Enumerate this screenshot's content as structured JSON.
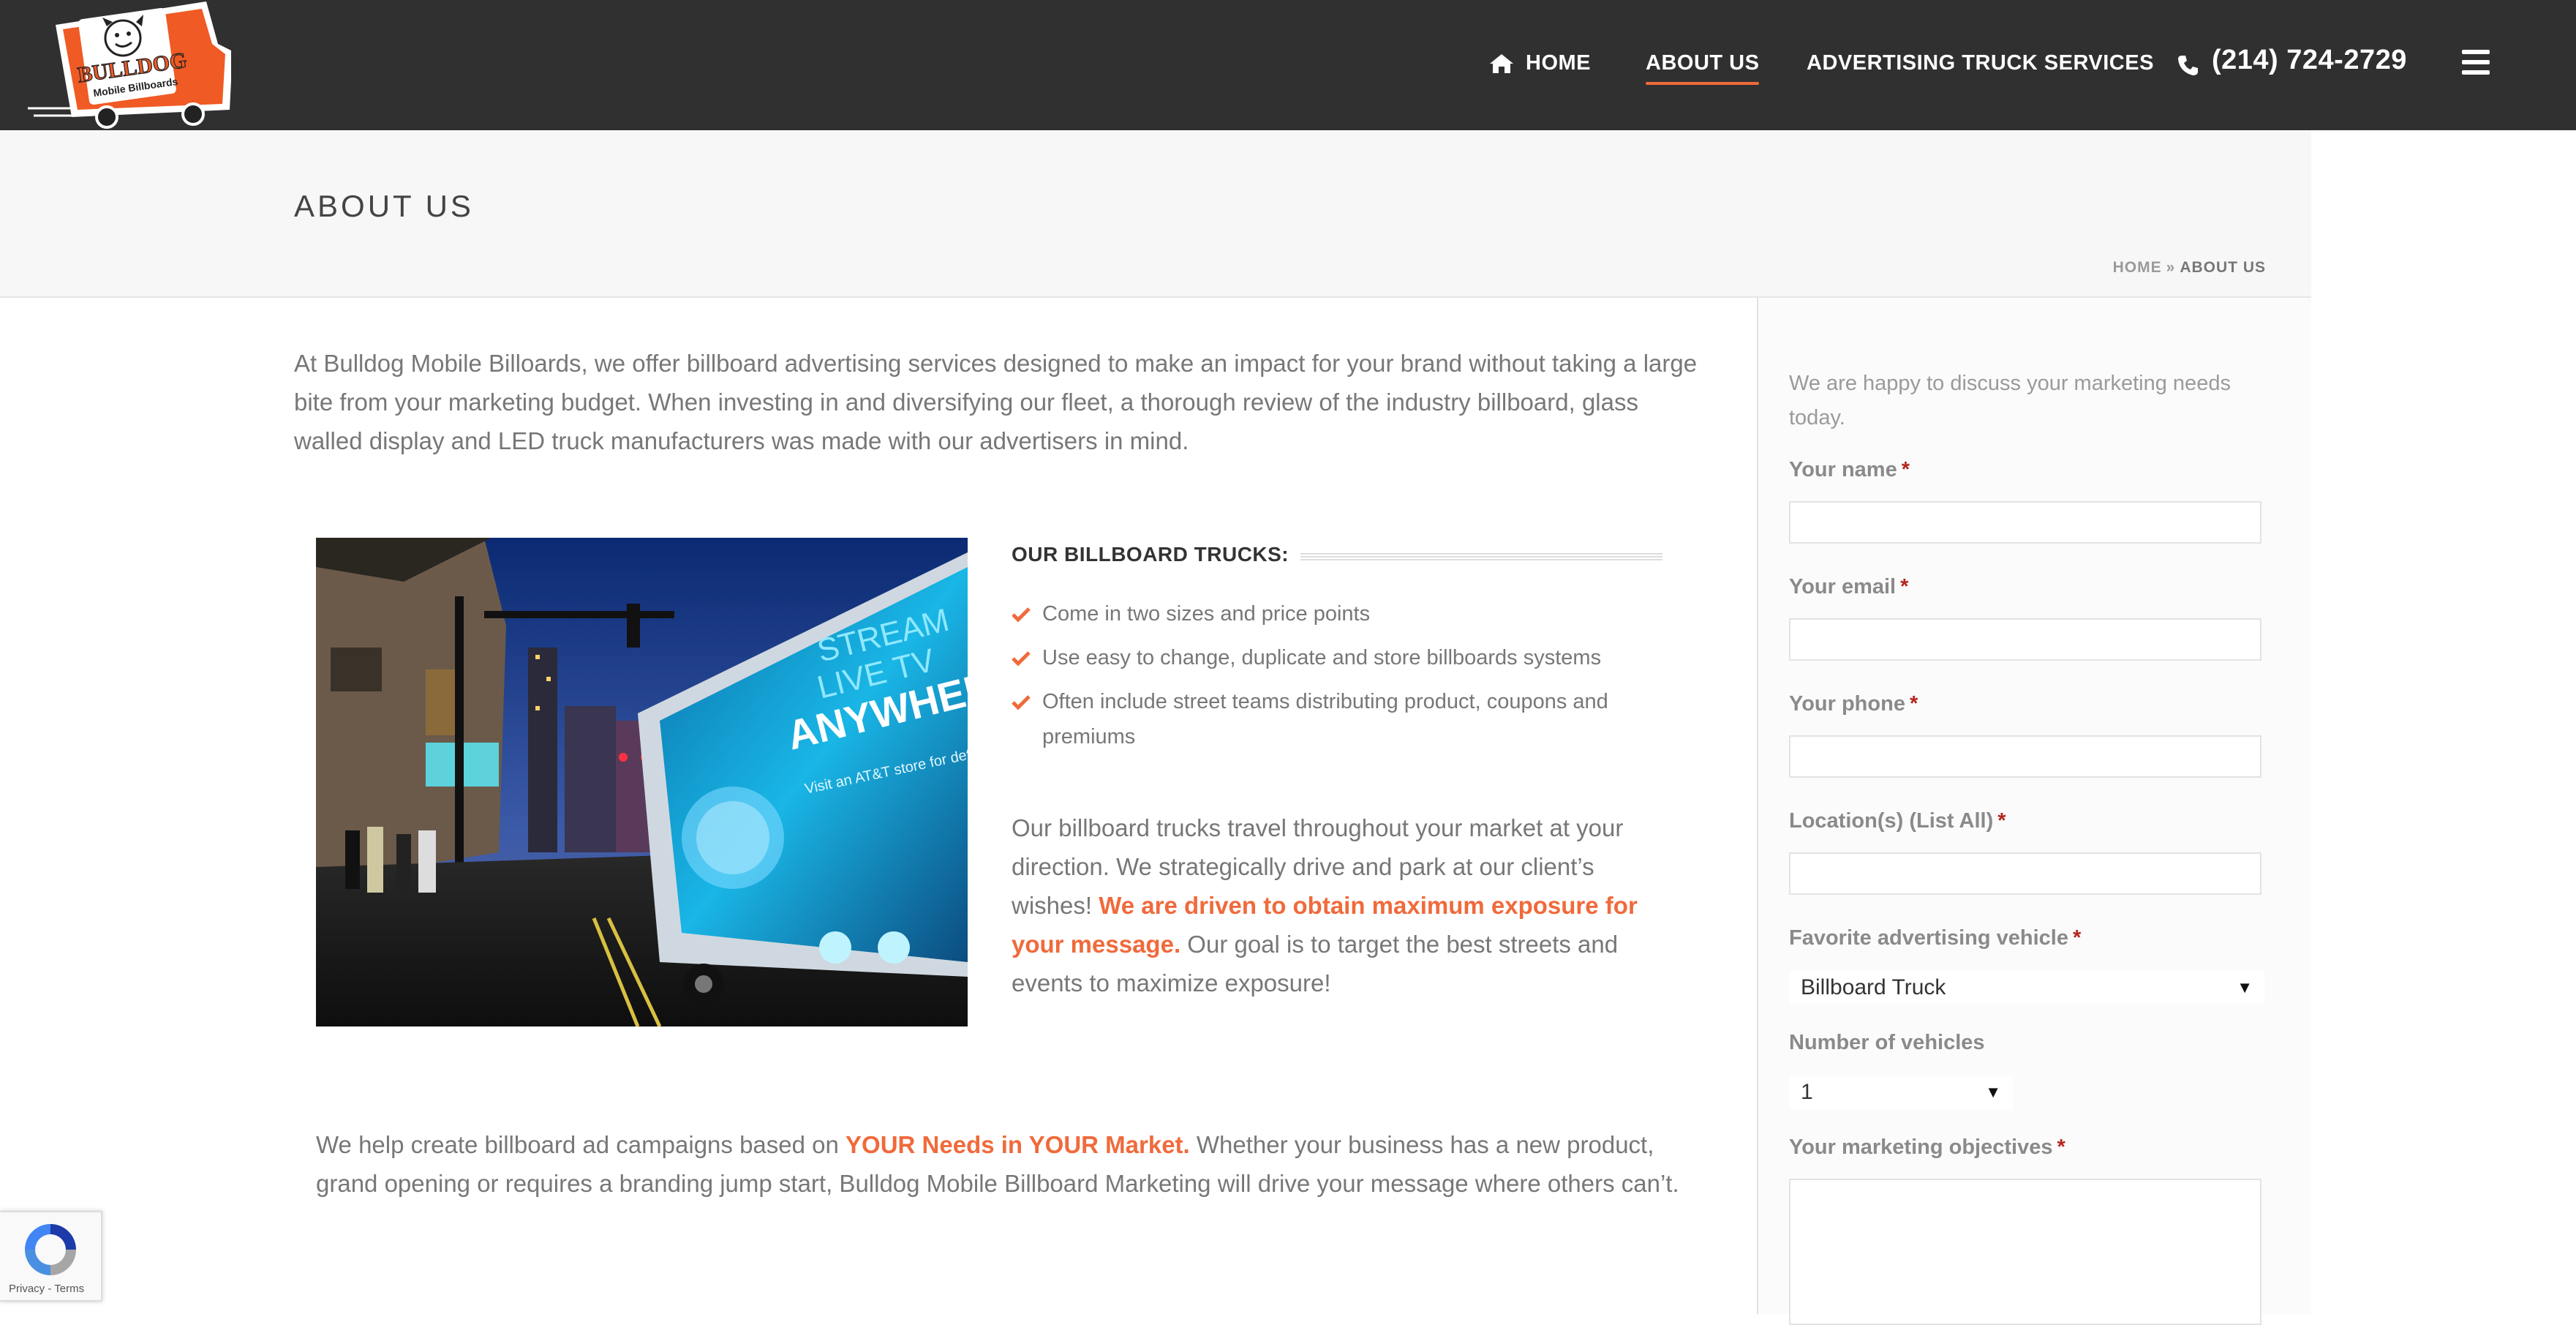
{
  "header": {
    "logo_line1": "BULLDOG",
    "logo_line2": "Mobile Billboards",
    "nav": {
      "home": "HOME",
      "about": "ABOUT US",
      "ads": "ADVERTISING TRUCK SERVICES",
      "phone": "(214) 724-2729"
    },
    "icons": {
      "home": "home-icon",
      "phone": "phone-icon",
      "menu": "hamburger-menu-icon"
    }
  },
  "title_bar": {
    "title": "ABOUT US",
    "breadcrumb": {
      "home": "HOME",
      "separator": "»",
      "current": "ABOUT US"
    }
  },
  "main": {
    "intro": "At Bulldog Mobile Billoards, we offer billboard advertising services designed to make an impact for your brand without taking a large bite from your marketing budget. When investing in and diversifying our fleet, a thorough review of the industry billboard, glass walled display and LED truck manufacturers was made with our advertisers in mind.",
    "photo": {
      "truck_text_1": "STREAM",
      "truck_text_2": "LIVE TV",
      "truck_text_3": "ANYWHERE",
      "truck_text_4": "Visit an AT&T store for details."
    },
    "trucks_heading": "OUR BILLBOARD TRUCKS:",
    "features": [
      "Come in two sizes and price points",
      "Use easy to change, duplicate and store billboards systems",
      "Often include street teams distributing product, coupons and premiums"
    ],
    "para2": {
      "text_before": "Our billboard trucks travel throughout your market at your direction. We strategically drive and park at our client’s wishes! ",
      "highlight": "We are driven to obtain maximum exposure for your message.",
      "text_after": " Our goal is to target the best streets and events to maximize exposure!"
    },
    "para3": {
      "text_before": "We help create billboard ad campaigns based on ",
      "highlight": "YOUR Needs in YOUR Market.",
      "text_after": " Whether your business has a new product, grand opening or requires a branding jump start, Bulldog Mobile Billboard Marketing will drive your message where others can’t."
    }
  },
  "form": {
    "intro": "We are happy to discuss your marketing needs today.",
    "required_mark": "*",
    "name_label": "Your name",
    "name_value": "",
    "email_label": "Your email",
    "email_value": "",
    "phone_label": "Your phone",
    "phone_value": "",
    "location_label": "Location(s) (List All)",
    "location_value": "",
    "vehicle_label": "Favorite advertising vehicle",
    "vehicle_selected": "Billboard Truck",
    "count_label": "Number of vehicles",
    "count_selected": "1",
    "objectives_label": "Your marketing objectives"
  },
  "recaptcha": {
    "privacy": "Privacy",
    "dash": " - ",
    "terms": "Terms"
  },
  "colors": {
    "header_bg": "#303030",
    "accent": "#f06a3b",
    "body_text": "#777777",
    "required": "#b3261e"
  }
}
